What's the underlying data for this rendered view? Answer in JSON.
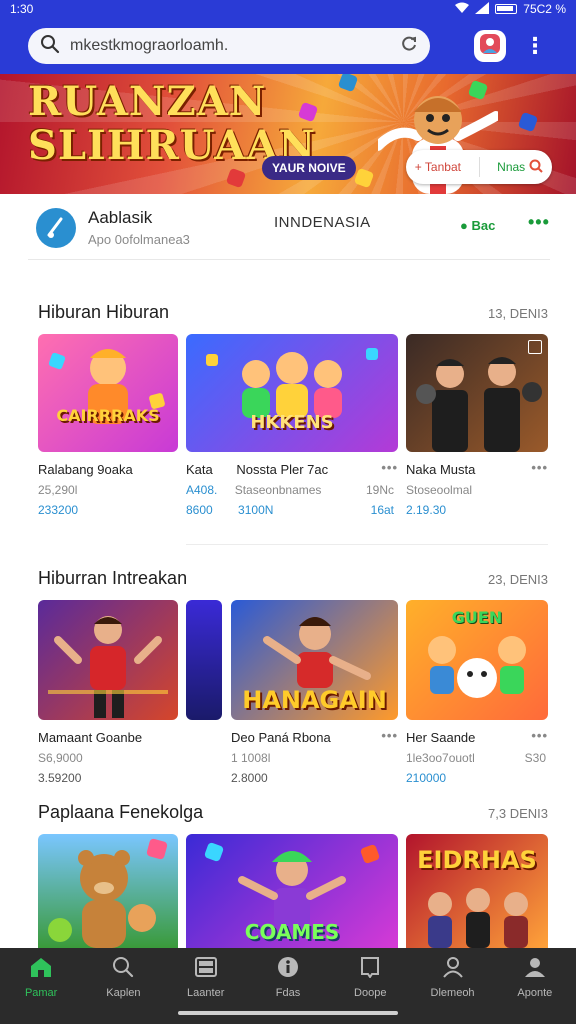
{
  "status_bar": {
    "time": "1:30",
    "battery_text": "75C2 %"
  },
  "search": {
    "value": "",
    "placeholder": "mkestkmograorloamh."
  },
  "banner": {
    "title_line1": "RUANZAN",
    "title_line2": "SLIHRUAAN",
    "badge": "YAUR NOIVE",
    "action_left": "+ Tanbat",
    "action_right": "Nnas"
  },
  "app_header": {
    "name": "Aablasik",
    "subtitle": "Apo 0ofolmanea3",
    "region": "INNDENASIA",
    "live": "Bac"
  },
  "sections": [
    {
      "title": "Hiburan Hiburan",
      "meta": "13, DENI3",
      "cards": [
        {
          "art": "CAIRRRAKS",
          "title": "Ralabang 9oaka",
          "line2": "25,290l",
          "line3": "233200",
          "palette": [
            "#ff6fb0",
            "#c83ad6"
          ]
        },
        {
          "art": "HKKENS",
          "title": "Kata",
          "title_right": "Nossta Pler 7ac",
          "line2": "A408.",
          "line2_right": "Staseonbnames",
          "line3": "8600",
          "line3_right": "3100N",
          "extra_line2": "19Nc",
          "extra_line3": "16at",
          "palette": [
            "#3a6bff",
            "#b43ad6"
          ]
        },
        {
          "art": "",
          "title": "Naka Musta",
          "line2": "Stoseoolmal",
          "line3": "2.19.30",
          "palette": [
            "#3a2a25",
            "#9a5a2a"
          ]
        }
      ]
    },
    {
      "title": "Hiburran  Intreakan",
      "meta": "23, DENI3",
      "cards": [
        {
          "art": "",
          "title": "Mamaant Goanbe",
          "line2": "S6,9000",
          "line3": "3.59200",
          "palette": [
            "#5a2a9a",
            "#d6462a"
          ]
        },
        {
          "art": "HANAGAIN",
          "title": "Deo Paná Rbona",
          "line2": "1 1008l",
          "line3": "2.8000",
          "palette": [
            "#2a5ad6",
            "#ff9a2a"
          ]
        },
        {
          "art": "GUEN",
          "title": "Her Saande",
          "line2": "1le3oo7ouotl",
          "line3": "210000",
          "extra": "S30",
          "palette": [
            "#ffb02a",
            "#ff6a3a"
          ]
        }
      ]
    },
    {
      "title": "Paplaana Fenekolga",
      "meta": "7,3 DENI3",
      "cards": [
        {
          "art": "",
          "palette": [
            "#3a9a3a",
            "#7ac6ff"
          ]
        },
        {
          "art": "COAMES",
          "palette": [
            "#3a2ad6",
            "#d63ad6"
          ]
        },
        {
          "art": "EIDRHAS",
          "palette": [
            "#b2142c",
            "#ffa33a"
          ]
        }
      ]
    }
  ],
  "nav": [
    {
      "label": "Pamar",
      "icon": "home-icon",
      "active": true
    },
    {
      "label": "Kaplen",
      "icon": "search-icon",
      "active": false
    },
    {
      "label": "Laanter",
      "icon": "grid-icon",
      "active": false
    },
    {
      "label": "Fdas",
      "icon": "info-icon",
      "active": false
    },
    {
      "label": "Doope",
      "icon": "bookmark-icon",
      "active": false
    },
    {
      "label": "Dlemeoh",
      "icon": "person-icon",
      "active": false
    },
    {
      "label": "Aponte",
      "icon": "profile-icon",
      "active": false
    }
  ],
  "colors": {
    "app_bar": "#2a3bd6",
    "accent_blue": "#2a8fd0",
    "accent_green": "#2fc25b",
    "nav_bg": "#2b2b2b"
  }
}
